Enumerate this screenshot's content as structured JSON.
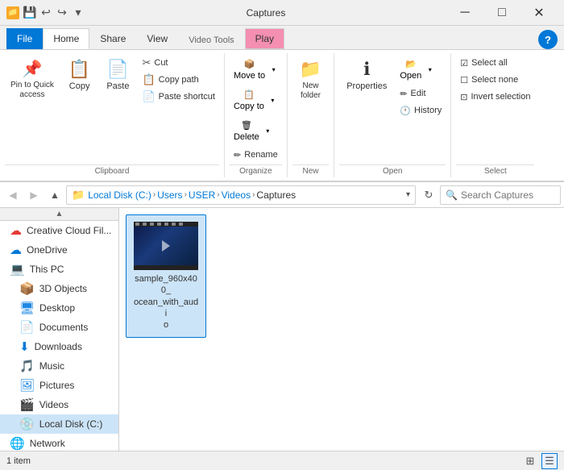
{
  "titlebar": {
    "app_title": "Captures",
    "min_label": "─",
    "max_label": "□",
    "close_label": "✕"
  },
  "tabs": {
    "file": "File",
    "home": "Home",
    "share": "Share",
    "view": "View",
    "video_tools": "Video Tools",
    "play": "Play"
  },
  "ribbon": {
    "clipboard_label": "Clipboard",
    "organize_label": "Organize",
    "new_label": "New",
    "open_label": "Open",
    "select_label": "Select",
    "pin_label": "Pin to Quick\naccess",
    "copy_label": "Copy",
    "paste_label": "Paste",
    "cut_label": "Cut",
    "copy_path_label": "Copy path",
    "paste_shortcut_label": "Paste shortcut",
    "move_to_label": "Move to",
    "delete_label": "Delete",
    "rename_label": "Rename",
    "copy_to_label": "Copy to",
    "new_folder_label": "New\nfolder",
    "open_label2": "Open",
    "edit_label": "Edit",
    "history_label": "History",
    "select_all_label": "Select all",
    "select_none_label": "Select none",
    "invert_label": "Invert selection",
    "properties_label": "Properties"
  },
  "address": {
    "path": "Local Disk (C:) › Users › USER › Videos › Captures",
    "parts": [
      "Local Disk (C:)",
      "Users",
      "USER",
      "Videos",
      "Captures"
    ],
    "search_placeholder": "Search Captures"
  },
  "sidebar": {
    "items": [
      {
        "label": "Creative Cloud Fil...",
        "icon": "cc",
        "indent": false
      },
      {
        "label": "OneDrive",
        "icon": "onedrive",
        "indent": false
      },
      {
        "label": "This PC",
        "icon": "pc",
        "indent": false
      },
      {
        "label": "3D Objects",
        "icon": "folder",
        "indent": true
      },
      {
        "label": "Desktop",
        "icon": "folder",
        "indent": true
      },
      {
        "label": "Documents",
        "icon": "folder",
        "indent": true
      },
      {
        "label": "Downloads",
        "icon": "downloads",
        "indent": true
      },
      {
        "label": "Music",
        "icon": "music",
        "indent": true
      },
      {
        "label": "Pictures",
        "icon": "folder",
        "indent": true
      },
      {
        "label": "Videos",
        "icon": "folder",
        "indent": true
      },
      {
        "label": "Local Disk (C:)",
        "icon": "disk",
        "indent": true,
        "selected": true
      },
      {
        "label": "Network",
        "icon": "network",
        "indent": false
      }
    ]
  },
  "files": [
    {
      "name": "sample_960x400_\nocean_with_audi\no",
      "type": "video"
    }
  ],
  "statusbar": {
    "count": "1 item"
  }
}
